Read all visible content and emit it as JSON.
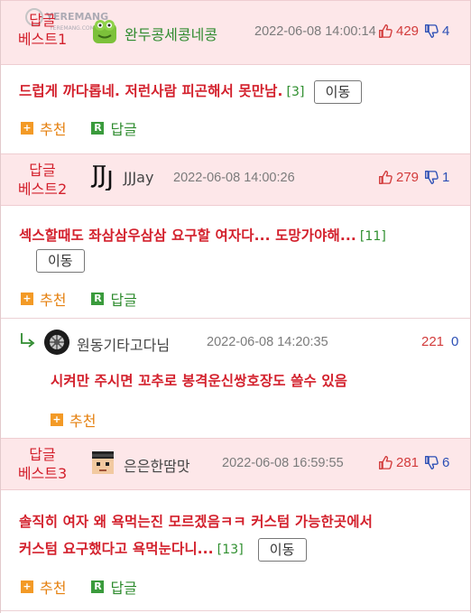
{
  "colors": {
    "accent_red": "#d3202c",
    "header_bg": "#fde7e9",
    "green": "#2e8b2e",
    "orange": "#e5800f",
    "blue": "#2c4fb5"
  },
  "watermark": {
    "text": "YEREMANG",
    "small": "YEREMANG.COM"
  },
  "posts": [
    {
      "best_line1": "답글",
      "best_line2": "베스트1",
      "avatar": "green-frog-avatar",
      "nick": "완두콩세콩네콩",
      "date": "2022-06-08 14:00:14",
      "up": "429",
      "down": "4",
      "text": "드럽게 까다롭네. 저런사람 피곤해서 못만남.",
      "reply_count": "[3]",
      "move": "이동",
      "recommend": "추천",
      "reply": "답글"
    },
    {
      "best_line1": "답글",
      "best_line2": "베스트2",
      "avatar": "jj-logo-avatar",
      "nick": "JJJay",
      "date": "2022-06-08 14:00:26",
      "up": "279",
      "down": "1",
      "text": "섹스할때도 좌삼삼우삼삼 요구할 여자다... 도망가야해...",
      "reply_count": "[11]",
      "move": "이동",
      "recommend": "추천",
      "reply": "답글"
    },
    {
      "best_line1": "답글",
      "best_line2": "베스트3",
      "avatar": "pixel-face-avatar",
      "nick": "은은한땀맛",
      "date": "2022-06-08 16:59:55",
      "up": "281",
      "down": "6",
      "text_line1": "솔직히 여자 왜 욕먹는진 모르겠음ㅋㅋ 커스텀 가능한곳에서",
      "text_line2": "커스텀 요구했다고 욕먹눈다니...",
      "reply_count": "[13]",
      "move": "이동",
      "recommend": "추천",
      "reply": "답글"
    }
  ],
  "subreply": {
    "avatar": "wheel-avatar",
    "nick": "원동기타고다님",
    "date": "2022-06-08 14:20:35",
    "up": "221",
    "down": "0",
    "text": "시켜만 주시면 꼬추로 봉격운신쌍호장도 쓸수 있음",
    "recommend": "추천"
  }
}
